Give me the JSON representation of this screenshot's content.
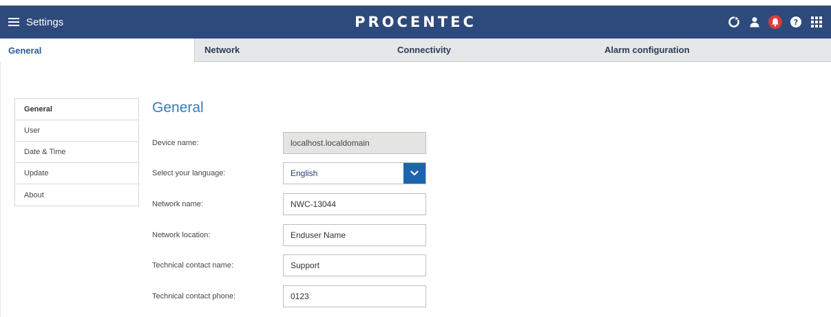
{
  "header": {
    "menu_label": "Settings",
    "logo_text": "PROCENTEC",
    "icons": [
      "refresh-icon",
      "user-icon",
      "bell-icon",
      "help-icon",
      "apps-grid-icon"
    ],
    "colors": {
      "background": "#2e4a7d",
      "alert": "#d93a3a"
    }
  },
  "tabs": [
    {
      "label": "General",
      "active": true
    },
    {
      "label": "Network",
      "active": false
    },
    {
      "label": "Connectivity",
      "active": false
    },
    {
      "label": "Alarm configuration",
      "active": false
    }
  ],
  "sidenav": {
    "items": [
      {
        "label": "General",
        "active": true
      },
      {
        "label": "User",
        "active": false
      },
      {
        "label": "Date & Time",
        "active": false
      },
      {
        "label": "Update",
        "active": false
      },
      {
        "label": "About",
        "active": false
      }
    ]
  },
  "main": {
    "title": "General",
    "fields": {
      "device_name": {
        "label": "Device name:",
        "value": "localhost.localdomain"
      },
      "language": {
        "label": "Select your language:",
        "value": "English"
      },
      "network_name": {
        "label": "Network name:",
        "value": "NWC-13044"
      },
      "network_location": {
        "label": "Network location:",
        "value": "Enduser Name"
      },
      "contact_name": {
        "label": "Technical contact name:",
        "value": "Support"
      },
      "contact_phone": {
        "label": "Technical contact phone:",
        "value": "0123"
      }
    }
  },
  "colors": {
    "accent": "#1d64b0",
    "title": "#2f7dbd"
  }
}
